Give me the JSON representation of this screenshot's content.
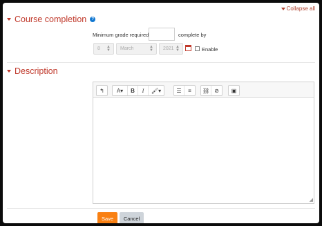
{
  "header": {
    "collapse_all_label": "Collapse all"
  },
  "completion": {
    "title": "Course completion",
    "min_grade_label": "Minimum grade required",
    "min_grade_value": "",
    "complete_by_label": "complete by",
    "day_value": "8",
    "month_value": "March",
    "year_value": "2021",
    "enable_label": "Enable",
    "enable_checked": false
  },
  "description": {
    "title": "Description",
    "editor_content": ""
  },
  "actions": {
    "save_label": "Save",
    "cancel_label": "Cancel"
  },
  "colors": {
    "accent": "#c0392b",
    "save": "#f98012",
    "cancel": "#ced4da",
    "help": "#1177d1"
  },
  "icons": [
    "chevron-down-icon",
    "help-icon",
    "calendar-icon",
    "undo-icon",
    "font-size-icon",
    "bold-icon",
    "italic-icon",
    "paint-brush-icon",
    "unordered-list-icon",
    "ordered-list-icon",
    "link-icon",
    "unlink-icon",
    "image-icon",
    "resize-handle-icon"
  ]
}
